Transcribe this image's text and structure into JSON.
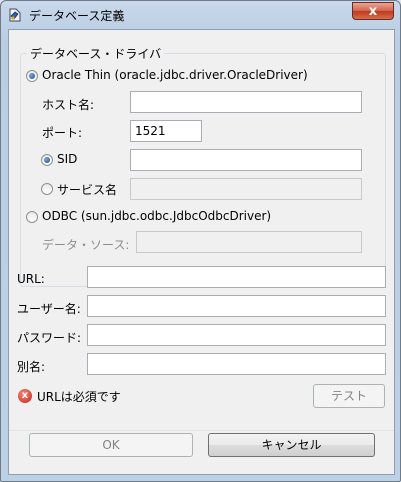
{
  "window": {
    "title": "データベース定義",
    "close_glyph": "x"
  },
  "group": {
    "label": "データベース・ドライバ"
  },
  "oracle": {
    "label": "Oracle Thin (oracle.jdbc.driver.OracleDriver)",
    "selected": true,
    "host_label": "ホスト名:",
    "host_value": "",
    "port_label": "ポート:",
    "port_value": "1521",
    "sid_label": "SID",
    "sid_selected": true,
    "sid_value": "",
    "service_label": "サービス名",
    "service_value": ""
  },
  "odbc": {
    "label": "ODBC (sun.jdbc.odbc.JdbcOdbcDriver)",
    "selected": false,
    "source_label": "データ・ソース:",
    "source_value": ""
  },
  "fields": {
    "url_label": "URL:",
    "url_value": "",
    "user_label": "ユーザー名:",
    "user_value": "",
    "password_label": "パスワード:",
    "password_value": "",
    "alias_label": "別名:",
    "alias_value": ""
  },
  "status": {
    "message": "URLは必須です",
    "icon": "error-icon"
  },
  "buttons": {
    "test": "テスト",
    "ok": "OK",
    "cancel": "キャンセル"
  }
}
